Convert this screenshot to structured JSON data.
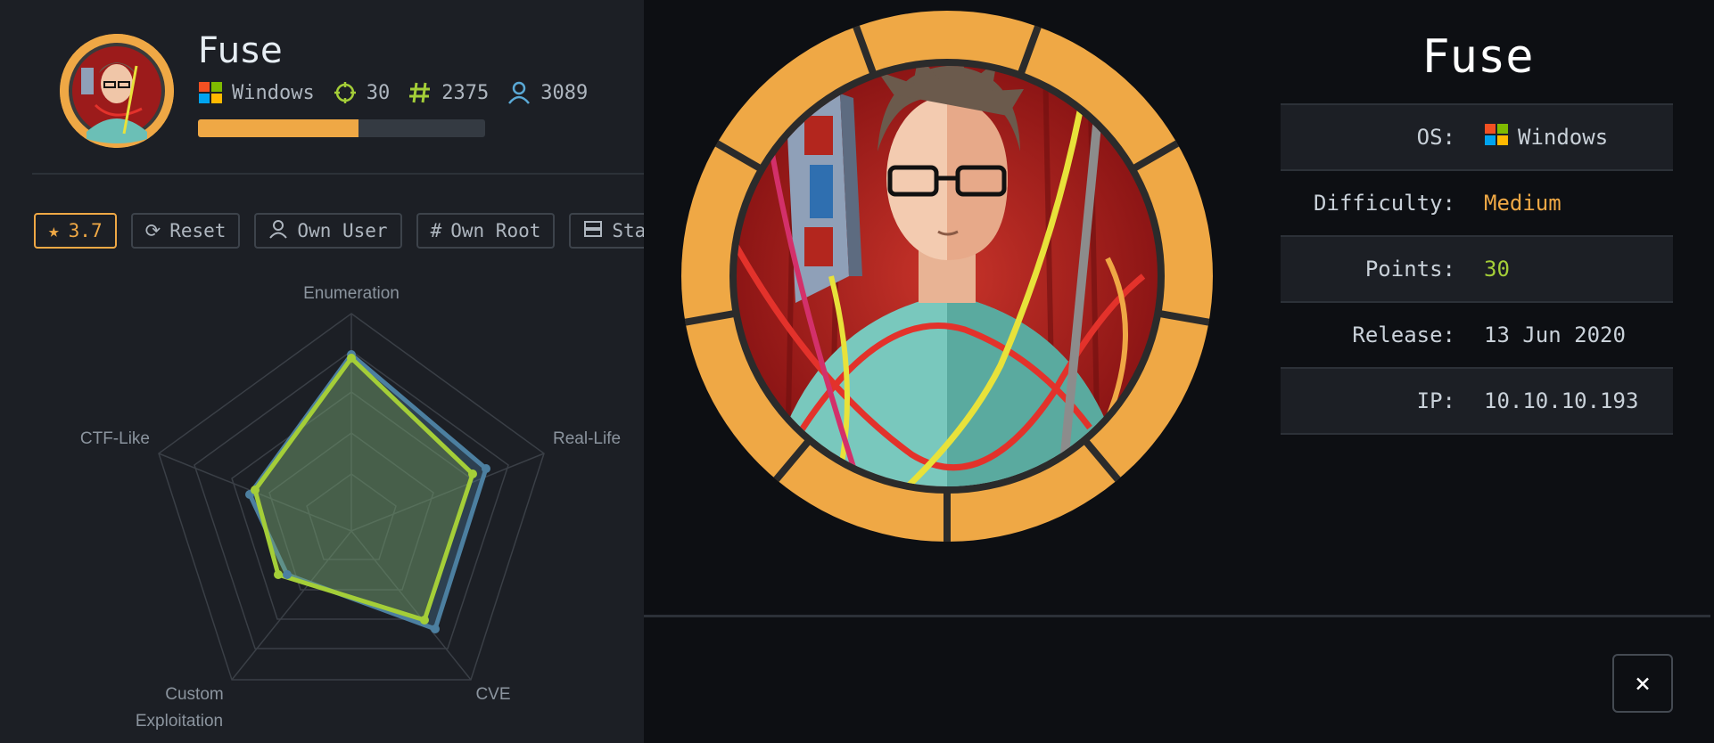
{
  "machine": {
    "name": "Fuse",
    "os": "Windows",
    "points": "30",
    "owns": "2375",
    "users": "3089",
    "progress": 0.56
  },
  "buttons": {
    "rating": "3.7",
    "reset": "Reset",
    "own_user": "Own User",
    "own_root": "Own Root",
    "status": "Status"
  },
  "radar": {
    "labels": {
      "enumeration": "Enumeration",
      "real_life": "Real-Life",
      "cve": "CVE",
      "custom_1": "Custom",
      "custom_2": "Exploitation",
      "ctf_like": "CTF-Like"
    },
    "colors": {
      "blue": "#4c7fa0",
      "green": "#a4ce38"
    }
  },
  "modal": {
    "title": "Fuse",
    "rows": {
      "os_label": "OS:",
      "os_value": "Windows",
      "difficulty_label": "Difficulty:",
      "difficulty_value": "Medium",
      "points_label": "Points:",
      "points_value": "30",
      "release_label": "Release:",
      "release_value": "13 Jun 2020",
      "ip_label": "IP:",
      "ip_value": "10.10.10.193"
    },
    "close_icon": "×"
  },
  "colors": {
    "accent": "#efa845",
    "points": "#a4ce38"
  }
}
